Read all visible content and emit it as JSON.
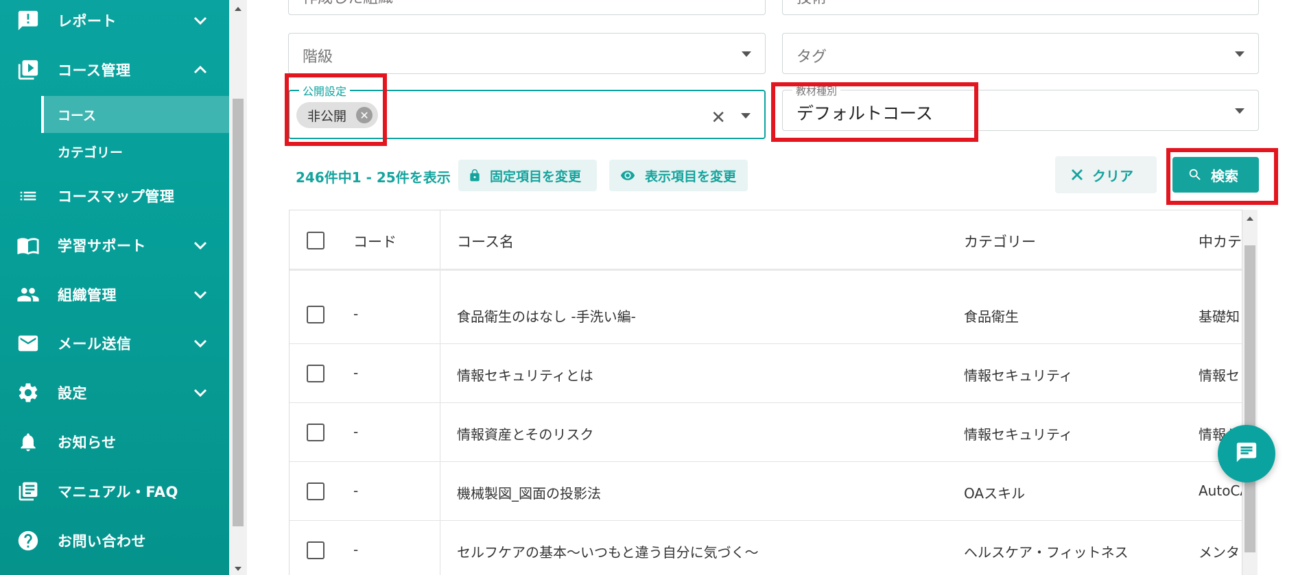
{
  "sidebar": {
    "items": [
      {
        "label": "レポート",
        "icon": "report-icon",
        "chevron": "down"
      },
      {
        "label": "コース管理",
        "icon": "play-library-icon",
        "chevron": "up"
      },
      {
        "label": "コースマップ管理",
        "icon": "list-icon"
      },
      {
        "label": "学習サポート",
        "icon": "book-icon",
        "chevron": "down"
      },
      {
        "label": "組織管理",
        "icon": "people-icon",
        "chevron": "down"
      },
      {
        "label": "メール送信",
        "icon": "mail-icon",
        "chevron": "down"
      },
      {
        "label": "設定",
        "icon": "gear-icon",
        "chevron": "down"
      },
      {
        "label": "お知らせ",
        "icon": "bell-icon"
      },
      {
        "label": "マニュアル・FAQ",
        "icon": "manual-icon"
      },
      {
        "label": "お問い合わせ",
        "icon": "help-icon"
      }
    ],
    "sub_items": [
      {
        "label": "コース",
        "active": true
      },
      {
        "label": "カテゴリー",
        "active": false
      }
    ]
  },
  "filters": {
    "top_left_partial": "作成した組織",
    "top_right_partial": "技術",
    "rank_placeholder": "階級",
    "tag_placeholder": "タグ",
    "publish_label": "公開設定",
    "publish_chip": "非公開",
    "material_label": "教材種別",
    "material_value": "デフォルトコース"
  },
  "toolbar": {
    "count_text": "246件中1 - 25件を表示",
    "fixed_button": "固定項目を変更",
    "display_button": "表示項目を変更",
    "clear_button": "クリア",
    "search_button": "検索"
  },
  "table": {
    "headers": [
      "コード",
      "コース名",
      "カテゴリー",
      "中カテ"
    ],
    "rows": [
      {
        "code": "-",
        "name": "食品衛生のはなし -手洗い編-",
        "category": "食品衛生",
        "sub": "基礎知"
      },
      {
        "code": "-",
        "name": "情報セキュリティとは",
        "category": "情報セキュリティ",
        "sub": "情報セ"
      },
      {
        "code": "-",
        "name": "情報資産とそのリスク",
        "category": "情報セキュリティ",
        "sub": "情報セ"
      },
      {
        "code": "-",
        "name": "機械製図_図面の投影法",
        "category": "OAスキル",
        "sub": "AutoCA"
      },
      {
        "code": "-",
        "name": "セルフケアの基本〜いつもと違う自分に気づく〜",
        "category": "ヘルスケア・フィットネス",
        "sub": "メンタ"
      }
    ]
  },
  "colors": {
    "brand": "#0aa39f",
    "highlight": "#e3151f"
  }
}
